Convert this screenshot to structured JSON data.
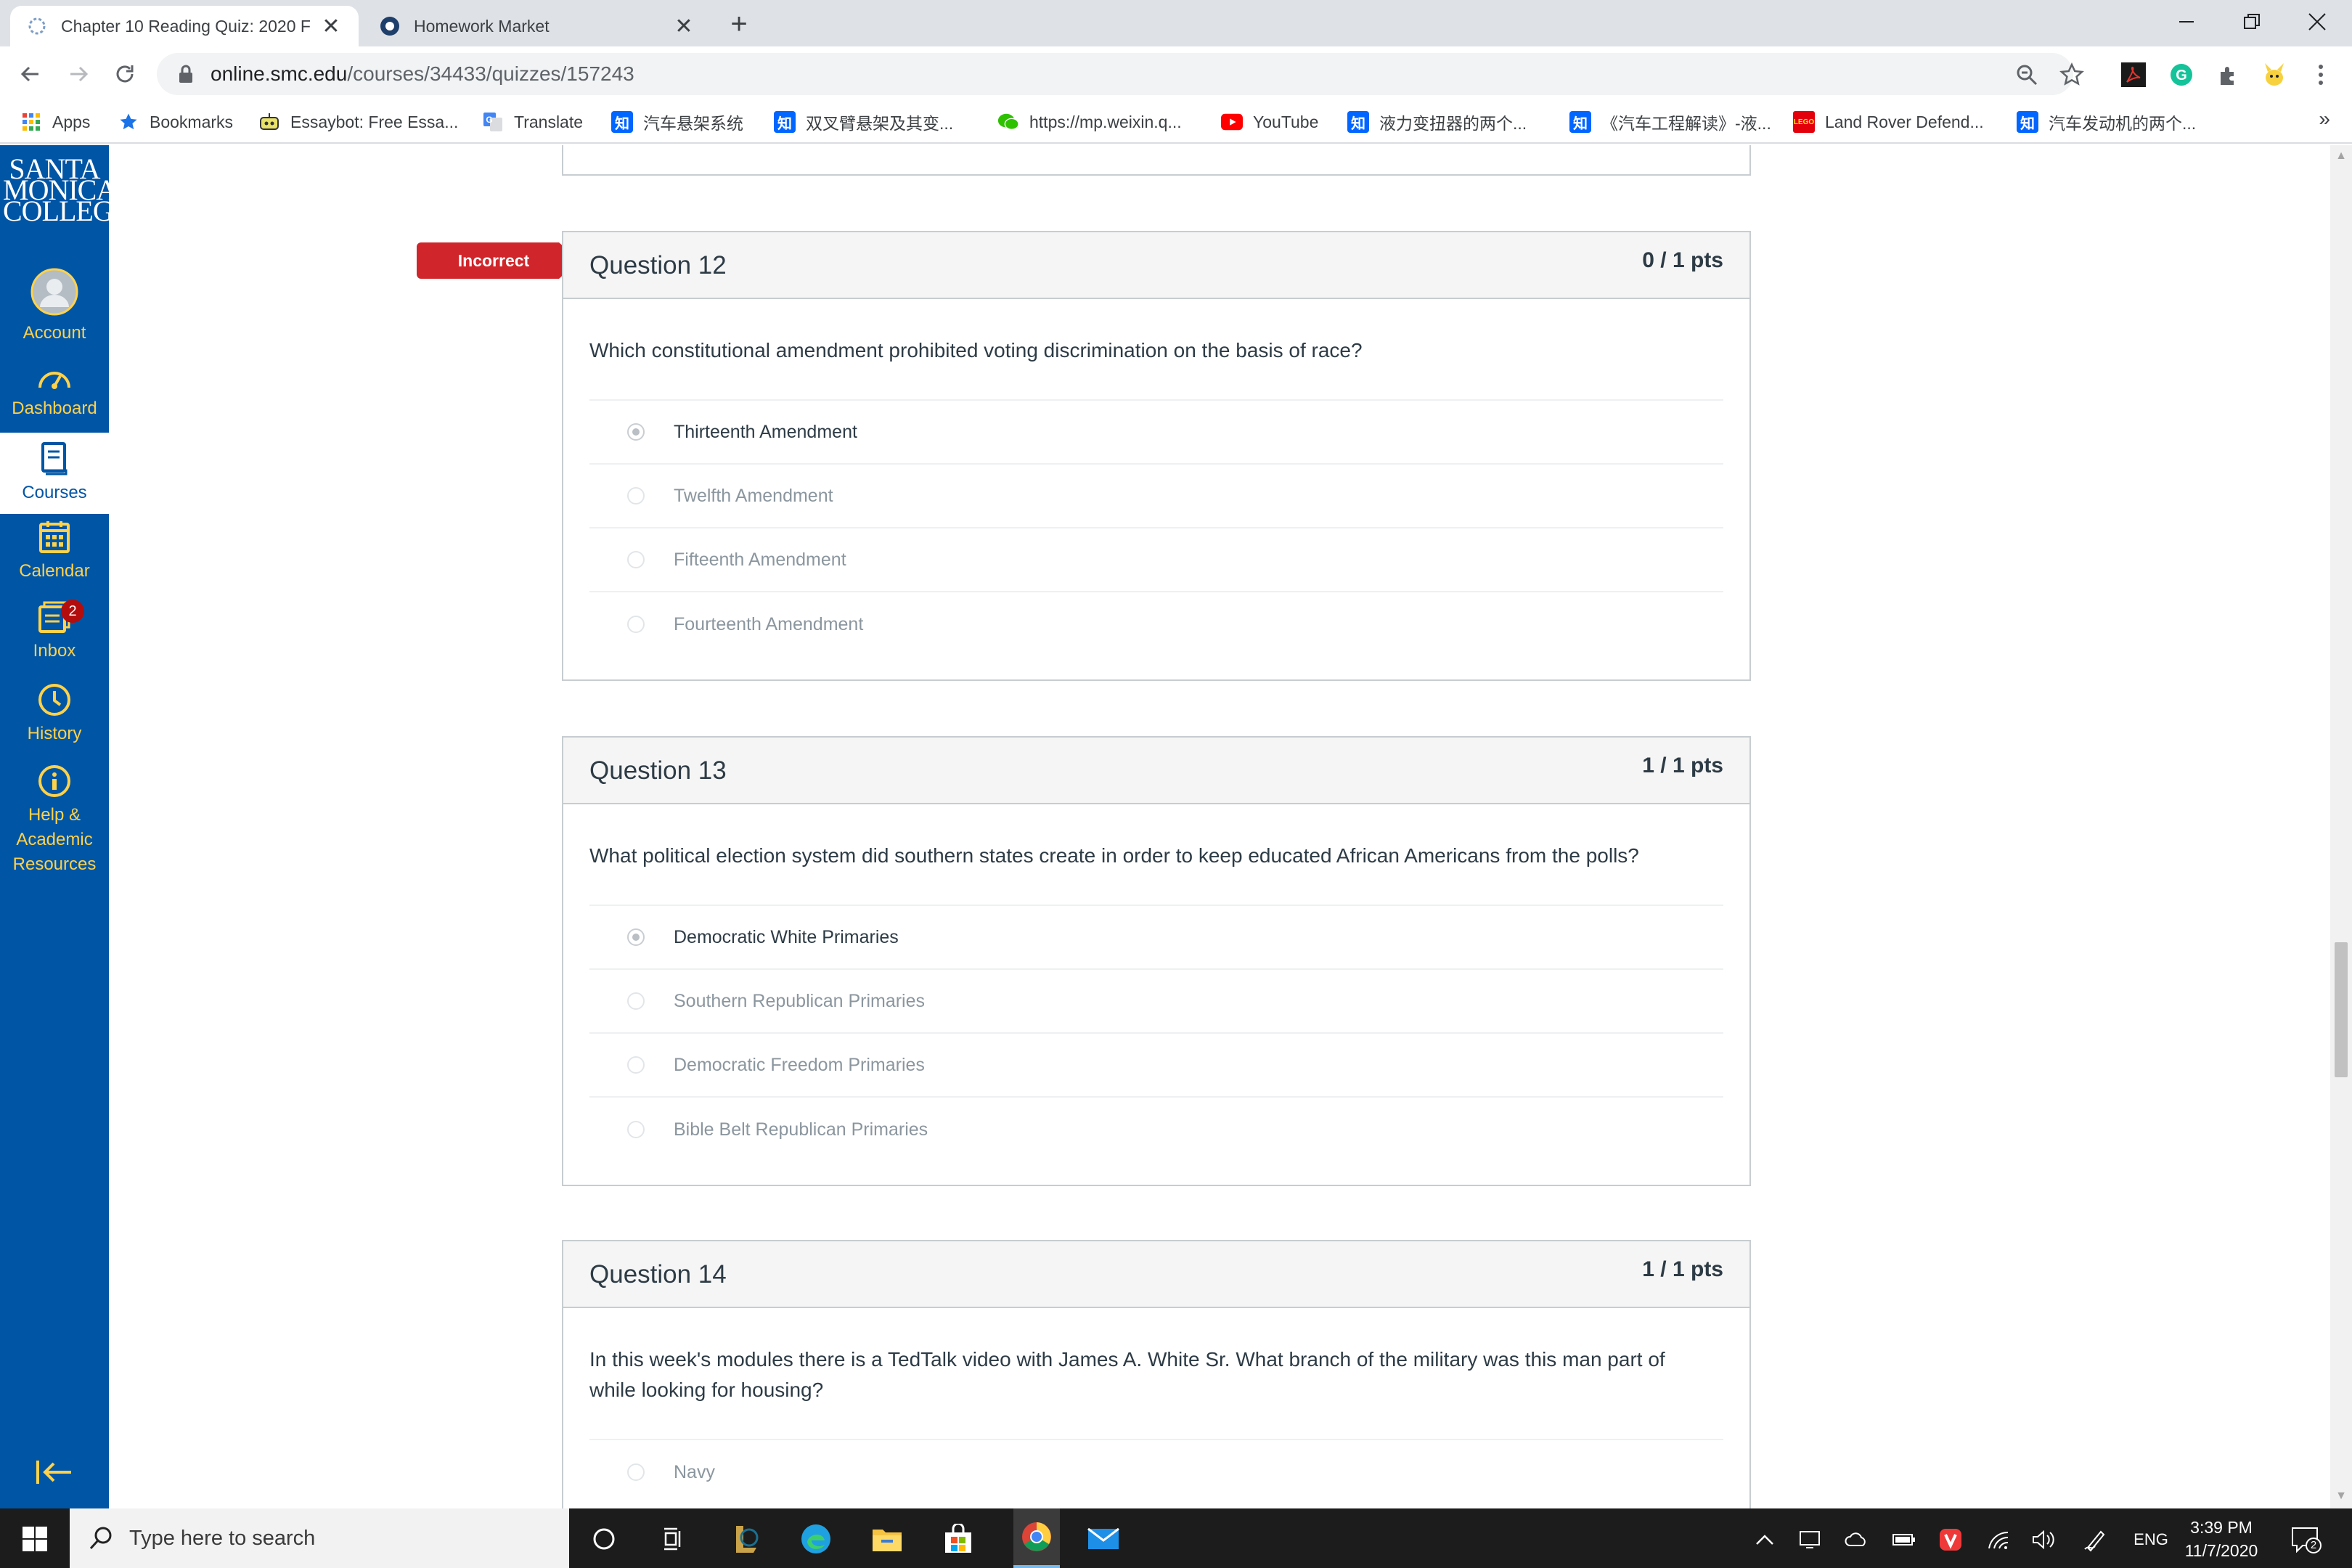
{
  "browser": {
    "tabs": [
      {
        "title": "Chapter 10 Reading Quiz: 2020 F",
        "active": true
      },
      {
        "title": "Homework Market",
        "active": false
      }
    ],
    "url_host": "online.smc.edu",
    "url_path": "/courses/34433/quizzes/157243",
    "bookmarks": [
      {
        "label": "Apps",
        "icon": "apps-grid-icon"
      },
      {
        "label": "Bookmarks",
        "icon": "star-icon"
      },
      {
        "label": "Essaybot: Free Essa...",
        "icon": "essaybot-icon"
      },
      {
        "label": "Translate",
        "icon": "google-translate-icon"
      },
      {
        "label": "汽车悬架系统",
        "icon": "zhihu-icon"
      },
      {
        "label": "双叉臂悬架及其变...",
        "icon": "zhihu-icon"
      },
      {
        "label": "https://mp.weixin.q...",
        "icon": "wechat-icon"
      },
      {
        "label": "YouTube",
        "icon": "youtube-icon"
      },
      {
        "label": "液力变扭器的两个...",
        "icon": "zhihu-icon"
      },
      {
        "label": "《汽车工程解读》-液...",
        "icon": "zhihu-icon"
      },
      {
        "label": "Land Rover Defend...",
        "icon": "lego-icon"
      },
      {
        "label": "汽车发动机的两个...",
        "icon": "zhihu-icon"
      }
    ],
    "bookmarks_more": "»",
    "zhihu_glyph": "知",
    "lego_glyph": "LEGO"
  },
  "nav": {
    "logo_lines": [
      "SANTA",
      "MONICA",
      "COLLEGE"
    ],
    "items": [
      {
        "label": "Account",
        "icon": "account-icon"
      },
      {
        "label": "Dashboard",
        "icon": "dashboard-icon"
      },
      {
        "label": "Courses",
        "icon": "courses-icon",
        "active": true
      },
      {
        "label": "Calendar",
        "icon": "calendar-icon"
      },
      {
        "label": "Inbox",
        "icon": "inbox-icon",
        "badge": "2"
      },
      {
        "label": "History",
        "icon": "history-icon"
      },
      {
        "label": "Help & Academic Resources",
        "icon": "help-icon"
      }
    ],
    "help_lines": [
      "Help &",
      "Academic",
      "Resources"
    ]
  },
  "quiz": {
    "incorrect_label": "Incorrect",
    "questions": [
      {
        "title": "Question 12",
        "points": "0 / 1 pts",
        "text": "Which constitutional amendment prohibited voting discrimination on the basis of race?",
        "answers": [
          "Thirteenth Amendment",
          "Twelfth Amendment",
          "Fifteenth Amendment",
          "Fourteenth Amendment"
        ],
        "selected": 0
      },
      {
        "title": "Question 13",
        "points": "1 / 1 pts",
        "text": "What political election system did southern states create in order to keep educated African Americans from the polls?",
        "answers": [
          "Democratic White Primaries",
          "Southern Republican Primaries",
          "Democratic Freedom Primaries",
          "Bible Belt Republican Primaries"
        ],
        "selected": 0
      },
      {
        "title": "Question 14",
        "points": "1 / 1 pts",
        "text": "In this week's modules there is a TedTalk video with James A. White Sr. What branch of the military was this man part of while looking for housing?",
        "answers": [
          "Navy"
        ],
        "selected": -1
      }
    ]
  },
  "taskbar": {
    "search_placeholder": "Type here to search",
    "language": "ENG",
    "time": "3:39 PM",
    "date": "11/7/2020",
    "notifications_count": "2"
  },
  "colors": {
    "nav_bg": "#0055a5",
    "nav_text": "#ffd24a",
    "incorrect_red": "#d0252a"
  }
}
